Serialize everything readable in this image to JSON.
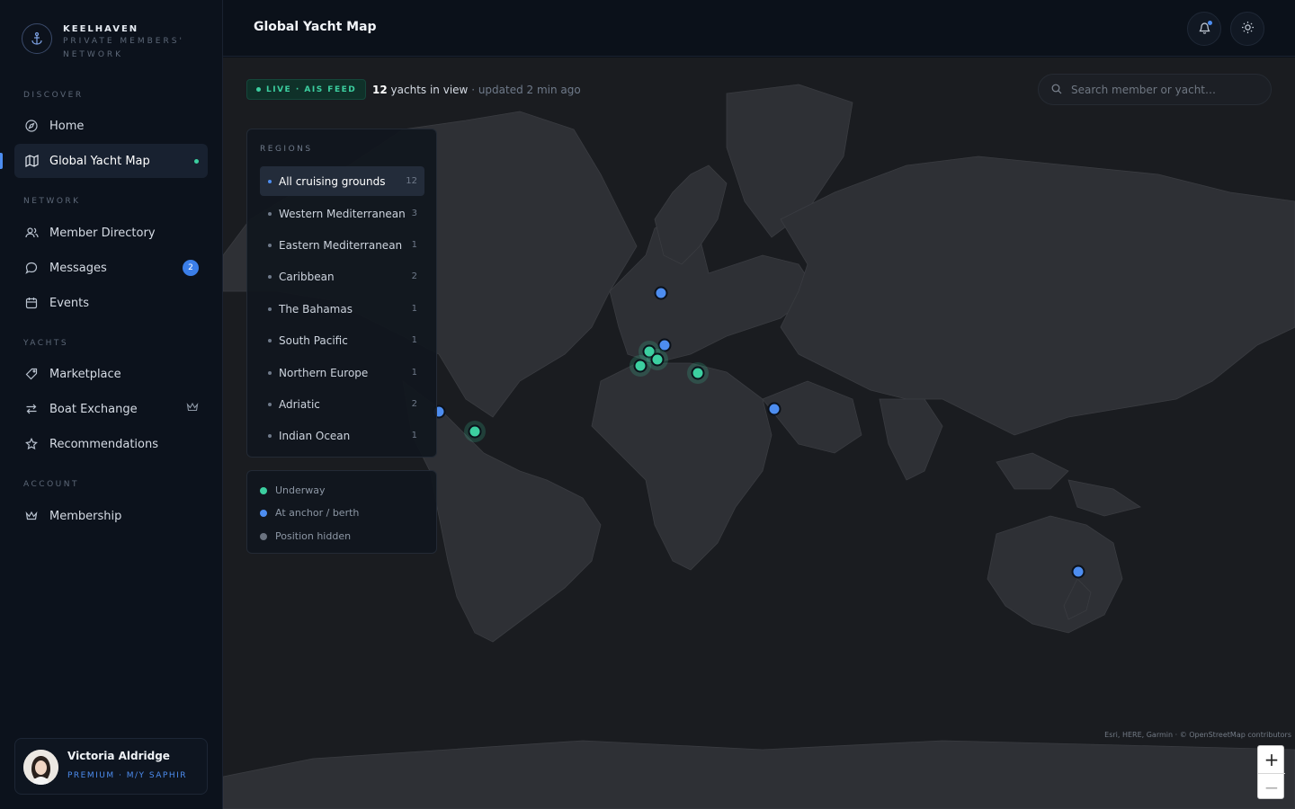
{
  "brand": {
    "name": "KEELHAVEN",
    "subtitle": "PRIVATE MEMBERS' NETWORK"
  },
  "sidebar": {
    "sections": [
      "DISCOVER",
      "NETWORK",
      "YACHTS",
      "ACCOUNT"
    ],
    "items": [
      {
        "label": "Home",
        "icon": "compass-icon"
      },
      {
        "label": "Global Yacht Map",
        "icon": "map-icon",
        "active": true
      },
      {
        "label": "Member Directory",
        "icon": "users-icon"
      },
      {
        "label": "Messages",
        "icon": "chat-icon",
        "badge": "2"
      },
      {
        "label": "Events",
        "icon": "calendar-icon"
      },
      {
        "label": "Marketplace",
        "icon": "tag-icon"
      },
      {
        "label": "Boat Exchange",
        "icon": "swap-icon"
      },
      {
        "label": "Recommendations",
        "icon": "star-icon"
      },
      {
        "label": "Membership",
        "icon": "crown-icon"
      }
    ]
  },
  "user": {
    "name": "Victoria Aldridge",
    "meta": "PREMIUM · M/Y SAPHIR"
  },
  "header": {
    "title": "Global Yacht Map"
  },
  "map": {
    "live_label": "LIVE · AIS FEED",
    "count": "12",
    "count_suffix": "yachts in view",
    "updated": "· updated 2 min ago",
    "search_placeholder": "Search member or yacht…",
    "attribution": "Esri, HERE, Garmin · © OpenStreetMap contributors",
    "zoom_in": "+",
    "zoom_out": "−"
  },
  "regions": {
    "heading": "REGIONS",
    "items": [
      {
        "label": "All cruising grounds",
        "count": "12",
        "active": true
      },
      {
        "label": "Western Mediterranean",
        "count": "3"
      },
      {
        "label": "Eastern Mediterranean",
        "count": "1"
      },
      {
        "label": "Caribbean",
        "count": "2"
      },
      {
        "label": "The Bahamas",
        "count": "1"
      },
      {
        "label": "South Pacific",
        "count": "1"
      },
      {
        "label": "Northern Europe",
        "count": "1"
      },
      {
        "label": "Adriatic",
        "count": "2"
      },
      {
        "label": "Indian Ocean",
        "count": "1"
      }
    ]
  },
  "legend": [
    {
      "label": "Underway",
      "color": "#3ccfa0"
    },
    {
      "label": "At anchor / berth",
      "color": "#4d8df0"
    },
    {
      "label": "Position hidden",
      "color": "#6b7380"
    }
  ],
  "colors": {
    "underway": "#3ccfa0",
    "anchor": "#4d8df0",
    "accent": "#4d8df0"
  }
}
